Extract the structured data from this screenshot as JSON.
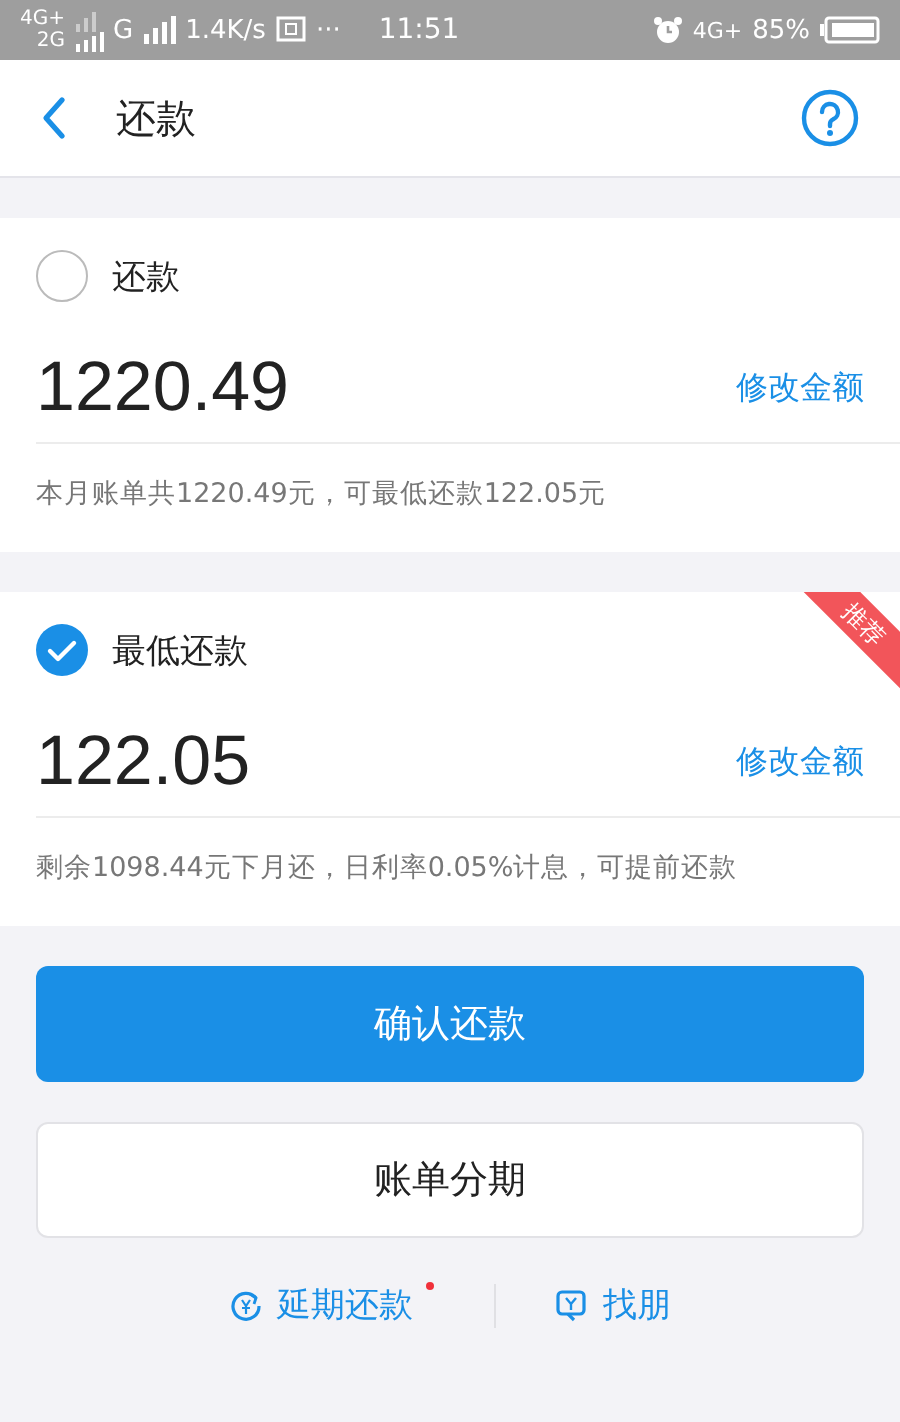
{
  "status_bar": {
    "net_top": "4G+",
    "net_bottom": "2G",
    "net2": "G",
    "speed": "1.4K/s",
    "more": "···",
    "time": "11:51",
    "net3": "4G+",
    "battery": "85%"
  },
  "nav": {
    "title": "还款"
  },
  "options": [
    {
      "label": "还款",
      "selected": false,
      "amount": "1220.49",
      "edit": "修改金额",
      "note": "本月账单共1220.49元，可最低还款122.05元"
    },
    {
      "label": "最低还款",
      "selected": true,
      "amount": "122.05",
      "edit": "修改金额",
      "note": "剩余1098.44元下月还，日利率0.05%计息，可提前还款",
      "badge": "推荐"
    }
  ],
  "buttons": [
    {
      "label": "确认还款",
      "kind": "primary"
    },
    {
      "label": "账单分期",
      "kind": "secondary"
    }
  ],
  "links": [
    {
      "label": "延期还款",
      "kind": "clock",
      "dot": true
    },
    {
      "label": "找朋",
      "kind": "chat",
      "dot": false
    }
  ]
}
